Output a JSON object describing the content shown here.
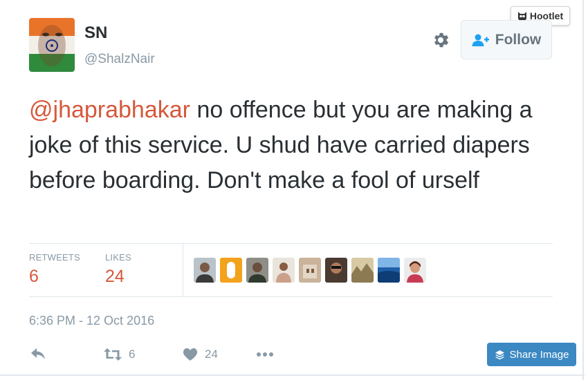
{
  "tweet": {
    "display_name": "SN",
    "handle": "@ShalzNair",
    "mention": "@jhaprabhakar",
    "text": " no offence but you are making a joke of this service. U shud have carried diapers before boarding. Don't make a fool of urself",
    "timestamp": "6:36 PM - 12 Oct 2016"
  },
  "header": {
    "follow_label": "Follow",
    "hootlet_label": "Hootlet"
  },
  "stats": {
    "retweets_label": "RETWEETS",
    "retweets_value": "6",
    "likes_label": "LIKES",
    "likes_value": "24"
  },
  "actions": {
    "retweet_count": "6",
    "like_count": "24"
  },
  "share": {
    "label": "Share Image"
  },
  "icons": [
    "reply-icon",
    "retweet-icon",
    "heart-icon",
    "more-icon",
    "gear-icon",
    "follow-person-icon",
    "owl-icon",
    "layers-icon"
  ],
  "colors": {
    "mention": "#d6583b",
    "stat_value": "#d6583b",
    "muted": "#8899a6",
    "share_button": "#3b88c3",
    "follow_icon": "#1da1f2"
  }
}
